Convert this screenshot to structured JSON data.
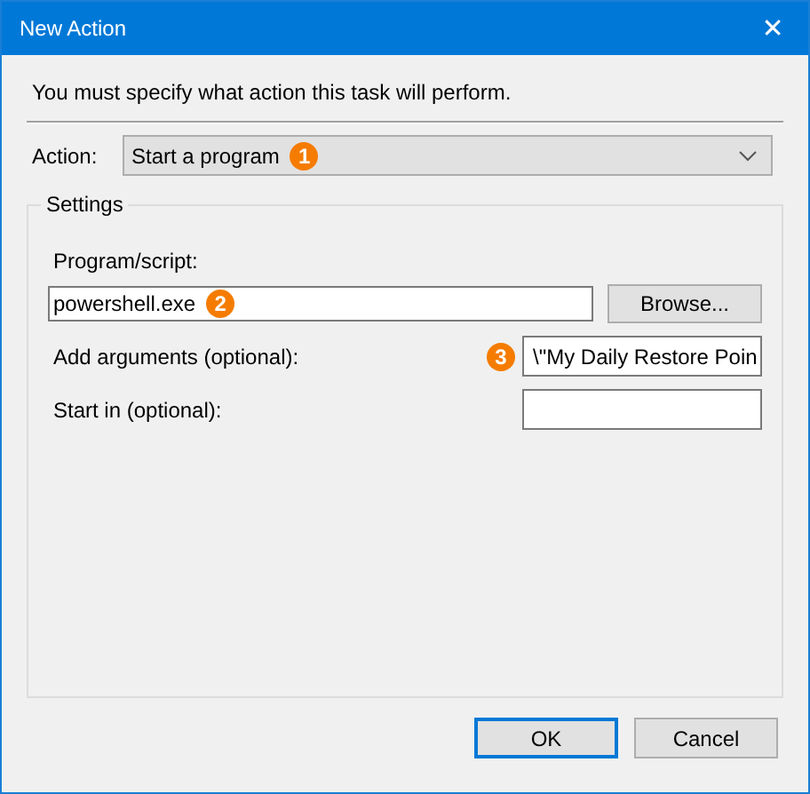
{
  "window": {
    "title": "New Action",
    "close": "✕"
  },
  "instruction": "You must specify what action this task will perform.",
  "action": {
    "label": "Action:",
    "value": "Start a program",
    "badge": "1"
  },
  "settings": {
    "legend": "Settings",
    "program": {
      "label": "Program/script:",
      "value": "powershell.exe",
      "badge": "2",
      "button": "Browse..."
    },
    "fields": [
      {
        "label": "Add arguments (optional):",
        "value": "\\\"My Daily Restore Poin",
        "badge": "3"
      },
      {
        "label": "Start in (optional):"
      }
    ]
  },
  "buttons": [
    {
      "label": "OK",
      "selected": true
    },
    {
      "label": "Cancel",
      "selected": false
    }
  ]
}
